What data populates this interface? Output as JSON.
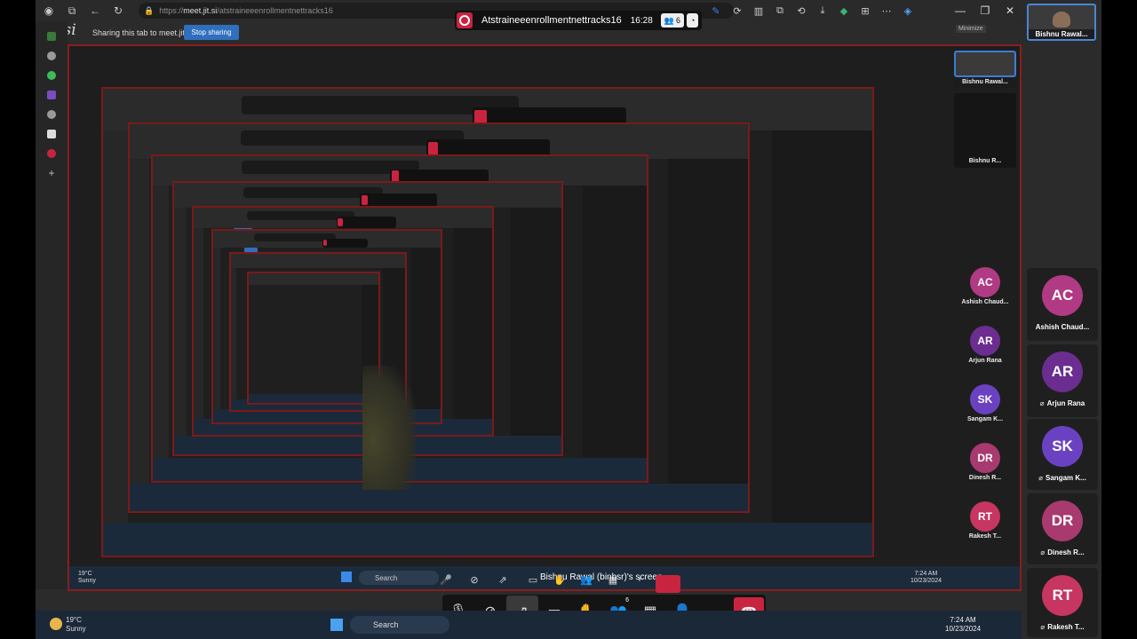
{
  "browser": {
    "url_prefix": "https://",
    "url_domain": "meet.jit.si",
    "url_path": "/atstraineeenrollmentnettracks16"
  },
  "meeting": {
    "title": "Atstraineeenrollmentnettracks16",
    "time": "16:28",
    "participant_count": "6"
  },
  "sharing_bar": {
    "logo": "jitsi",
    "text": "Sharing this tab to meet.jit.si",
    "stop_label": "Stop sharing"
  },
  "minimize_tooltip": "Minimize",
  "stage_participants": [
    {
      "name": "Bishnu Rawal...",
      "type": "video"
    },
    {
      "name": "Bishnu R...",
      "type": "screen"
    },
    {
      "initials": "AC",
      "name": "Ashish Chaud...",
      "color": "#b03a84"
    },
    {
      "initials": "AR",
      "name": "Arjun Rana",
      "color": "#6b2d90"
    },
    {
      "initials": "SK",
      "name": "Sangam K...",
      "color": "#6a42c1"
    },
    {
      "initials": "DR",
      "name": "Dinesh R...",
      "color": "#a83a6f"
    },
    {
      "initials": "RT",
      "name": "Rakesh T...",
      "color": "#c73561"
    }
  ],
  "far_right": {
    "video_name": "Bishnu Rawal...",
    "participants": [
      {
        "initials": "AC",
        "name": "Ashish Chaud...",
        "color": "#b03a84"
      },
      {
        "initials": "AR",
        "name": "Arjun Rana",
        "color": "#6b2d90"
      },
      {
        "initials": "SK",
        "name": "Sangam K...",
        "color": "#6a42c1"
      },
      {
        "initials": "DR",
        "name": "Dinesh R...",
        "color": "#a83a6f"
      },
      {
        "initials": "RT",
        "name": "Rakesh T...",
        "color": "#c73561"
      }
    ]
  },
  "screen_label": "Bishnu Rawal (binbsr)'s screen",
  "toolbar": {
    "participants_count": "6"
  },
  "taskbar": {
    "temperature": "19°C",
    "weather": "Sunny",
    "search": "Search",
    "time": "7:24 AM",
    "date": "10/23/2024"
  },
  "colors": {
    "accent": "#2f6fbd",
    "record": "#c9243f",
    "share_border": "#8b1d1d"
  }
}
